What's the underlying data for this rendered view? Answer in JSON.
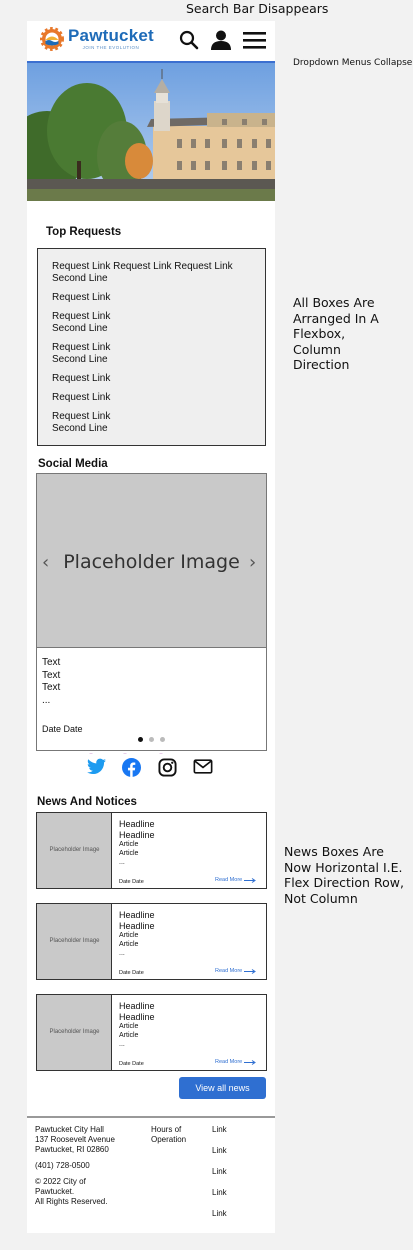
{
  "annotations": {
    "search": "Search Bar Disappears",
    "dropdown": "Dropdown Menus Collapse",
    "flexbox": "All Boxes Are Arranged In A Flexbox, Column Direction",
    "news": "News Boxes Are Now Horizontal I.E. Flex Direction Row, Not Column"
  },
  "header": {
    "logo_name": "Pawtucket",
    "logo_tagline": "JOIN THE EVOLUTION",
    "icons": [
      "search-icon",
      "user-icon",
      "menu-icon"
    ]
  },
  "top_requests": {
    "title": "Top Requests",
    "items": [
      "Request Link Request Link Request Link Second Line",
      "Request Link",
      "Request Link Second Line",
      "Request Link Second Line",
      "Request Link",
      "Request Link",
      "Request Link Second Line"
    ]
  },
  "social": {
    "title": "Social Media",
    "image_placeholder": "Placeholder Image",
    "text_lines": [
      "Text",
      "Text",
      "Text",
      "..."
    ],
    "date": "Date Date",
    "icons": [
      "twitter-icon",
      "facebook-icon",
      "instagram-icon",
      "mail-icon"
    ]
  },
  "news": {
    "title": "News And Notices",
    "items": [
      {
        "image": "Placeholder Image",
        "headline": [
          "Headline",
          "Headline"
        ],
        "article": [
          "Article",
          "Article",
          "..."
        ],
        "date": "Date Date",
        "read_more": "Read More"
      },
      {
        "image": "Placeholder Image",
        "headline": [
          "Headline",
          "Headline"
        ],
        "article": [
          "Article",
          "Article",
          "..."
        ],
        "date": "Date Date",
        "read_more": "Read More"
      },
      {
        "image": "Placeholder Image",
        "headline": [
          "Headline",
          "Headline"
        ],
        "article": [
          "Article",
          "Article",
          "..."
        ],
        "date": "Date Date",
        "read_more": "Read More"
      }
    ],
    "view_all": "View all news"
  },
  "footer": {
    "address": [
      "Pawtucket City Hall",
      "137 Roosevelt Avenue",
      "Pawtucket, RI 02860"
    ],
    "phone": "(401) 728-0500",
    "copyright": [
      "© 2022 City of Pawtucket.",
      "All Rights Reserved."
    ],
    "hours": "Hours of Operation",
    "links": [
      "Link",
      "Link",
      "Link",
      "Link",
      "Link"
    ]
  },
  "colors": {
    "brand_blue": "#1e6bb8",
    "accent_blue": "#2f6fd1",
    "placeholder_gray": "#c9c9c9",
    "box_gray": "#efefef"
  }
}
